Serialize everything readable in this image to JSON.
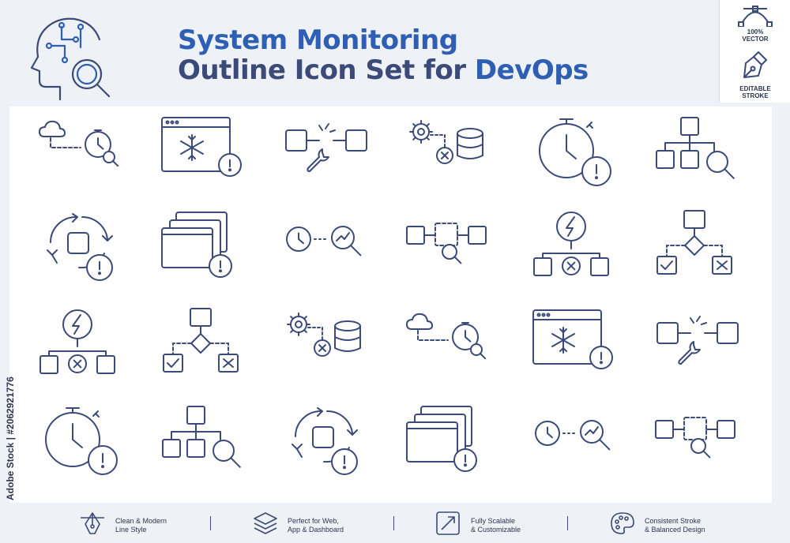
{
  "header": {
    "title_line1": "System Monitoring",
    "title_line2_prefix": "Outline Icon Set for ",
    "title_line2_accent": "DevOps"
  },
  "badges": {
    "vector_line1": "100%",
    "vector_line2": "VECTOR",
    "stroke_line1": "EDITABLE",
    "stroke_line2": "STROKE"
  },
  "icons": [
    "cloud-stopwatch-search-icon",
    "browser-freeze-alert-icon",
    "node-break-wrench-icon",
    "gear-database-error-icon",
    "stopwatch-alert-icon",
    "hierarchy-search-icon",
    "cycle-alert-icon",
    "stacked-windows-alert-icon",
    "clock-trend-search-icon",
    "dashed-node-search-icon",
    "power-flow-error-icon",
    "decision-flow-icon",
    "power-flow-error-icon",
    "decision-flow-icon",
    "gear-database-error-icon",
    "cloud-stopwatch-search-icon",
    "browser-freeze-alert-icon",
    "node-break-wrench-icon",
    "stopwatch-alert-icon",
    "hierarchy-search-icon",
    "cycle-alert-icon",
    "stacked-windows-alert-icon",
    "clock-trend-search-icon",
    "dashed-node-search-icon"
  ],
  "footer": {
    "f1_line1": "Clean & Modern",
    "f1_line2": "Line Style",
    "f2_line1": "Perfect for Web,",
    "f2_line2": "App & Dashboard",
    "f3_line1": "Fully Scalable",
    "f3_line2": "& Customizable",
    "f4_line1": "Consistent Stroke",
    "f4_line2": "& Balanced Design"
  },
  "watermark": "Adobe Stock | #2062921776",
  "colors": {
    "accent": "#2f5fb3",
    "stroke": "#3b4a78",
    "background": "#eef1f6"
  }
}
